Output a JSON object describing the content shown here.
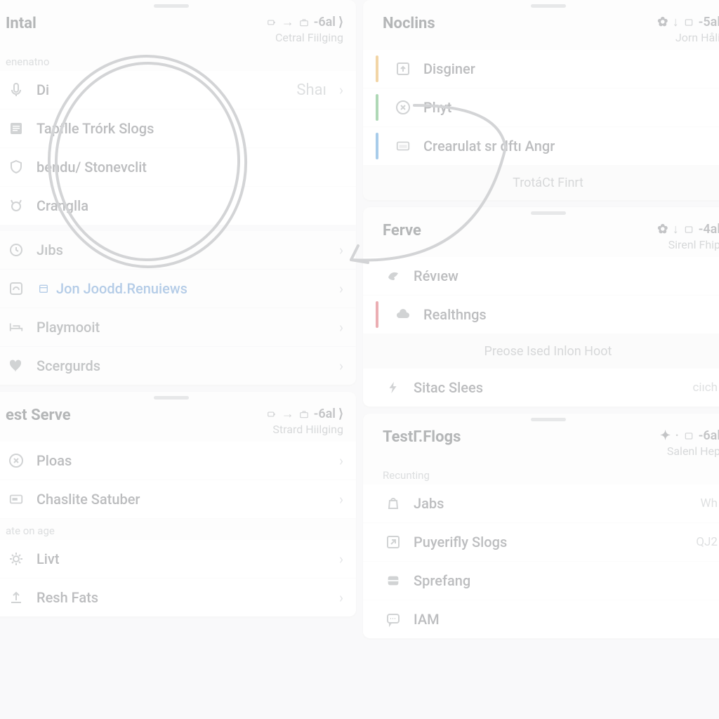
{
  "panels": {
    "intal": {
      "title": "Intal",
      "status": "-6al",
      "subtitle": "Cetral Fiilging",
      "section1_label": "enenatno",
      "items1": [
        {
          "label": "Di",
          "badge": "Shaı"
        },
        {
          "label": "Tapflle Trórk Slogs",
          "badge": ""
        },
        {
          "label": "bendu/ Stonevclit",
          "badge": ""
        },
        {
          "label": "Cranglla",
          "badge": ""
        }
      ],
      "items2": [
        {
          "label": "Jıbs"
        },
        {
          "label": "Jon Joodd.Renuiews"
        },
        {
          "label": "Playmooit"
        },
        {
          "label": "Scergurds"
        }
      ]
    },
    "noclins": {
      "title": "Noclins",
      "status": "-5al",
      "subtitle": "Jorn Håli",
      "items": [
        {
          "color": "#e2a23a",
          "label": "Disginer"
        },
        {
          "color": "#4fa85e",
          "label": "Phyt"
        },
        {
          "color": "#3f8fd1",
          "label": "Crearulat sr dftı Angr"
        }
      ],
      "footer": "TrotáCt Finrt"
    },
    "ferve": {
      "title": "Ferve",
      "status": "-4al",
      "subtitle": "Sirenl Fhip",
      "items": [
        {
          "color": "",
          "label": "Révıew"
        },
        {
          "color": "#d24d57",
          "label": "Realthngs"
        }
      ],
      "footer": "Preose Ised Inlon Hoot",
      "extra": {
        "label": "Sitac Slees",
        "badge": "ciıch"
      }
    },
    "estserve": {
      "title": "est Serve",
      "status": "-6al",
      "subtitle": "Strard Hiilging",
      "items1": [
        {
          "label": "Ploas"
        },
        {
          "label": "Chaslite Satuber"
        }
      ],
      "section2_label": "ate on age",
      "items2": [
        {
          "label": "Livt"
        },
        {
          "label": "Resh Fats"
        }
      ]
    },
    "testflogs": {
      "title": "TestГ.Flogs",
      "status": "-6al",
      "subtitle": "Salenl Hep",
      "section_label": "Recunting",
      "items": [
        {
          "label": "Jabs",
          "badge": "Wh"
        },
        {
          "label": "Puyerifly Slogs",
          "badge": "QJ2"
        },
        {
          "label": "Sprefang",
          "badge": ""
        },
        {
          "label": "IAM",
          "badge": ""
        }
      ]
    }
  }
}
